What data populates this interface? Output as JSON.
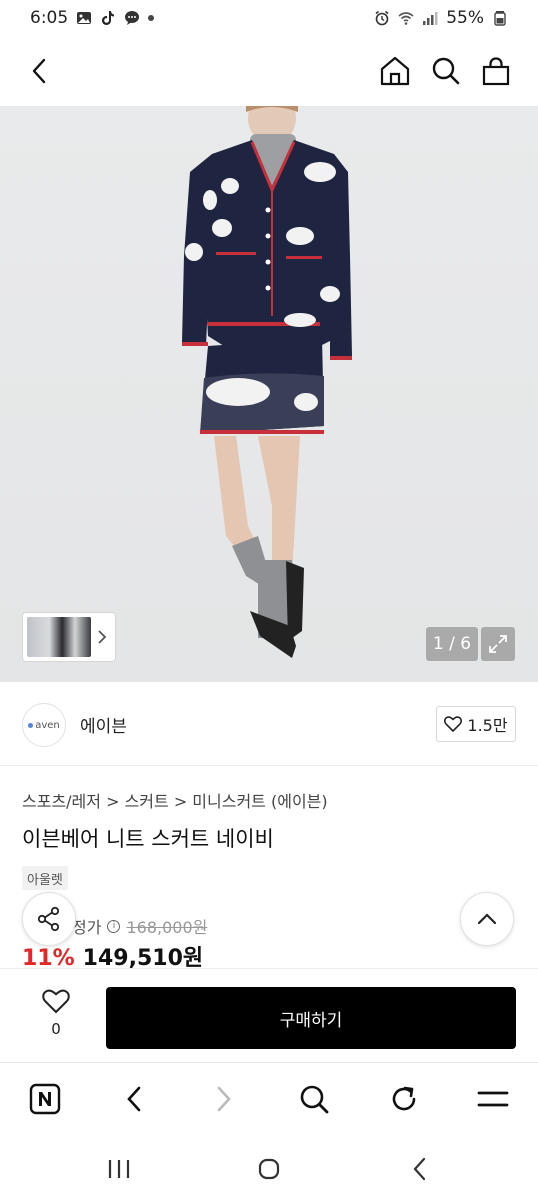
{
  "status_bar": {
    "time": "6:05",
    "battery": "55%"
  },
  "header": {
    "icons": [
      "back-icon",
      "home-icon",
      "search-icon",
      "bag-icon"
    ]
  },
  "gallery": {
    "counter": "1 / 6"
  },
  "brand": {
    "logo_text": "aven",
    "name": "에이븐",
    "likes": "1.5만"
  },
  "product": {
    "breadcrumb": "스포츠/레저 > 스커트 > 미니스커트 (에이븐)",
    "title": "이븐베어 니트 스커트 네이비",
    "badge": "아울렛",
    "original_price_label": "정가",
    "original_price": "168,000원",
    "discount": "11%",
    "price": "149,510원"
  },
  "purchase_bar": {
    "wish_count": "0",
    "buy_label": "구매하기"
  },
  "browser_bar": {
    "icons": [
      "naver-icon",
      "back-icon",
      "forward-icon",
      "search-icon",
      "refresh-icon",
      "menu-icon"
    ]
  },
  "colors": {
    "discount": "#e32628",
    "buy_button": "#000000"
  }
}
